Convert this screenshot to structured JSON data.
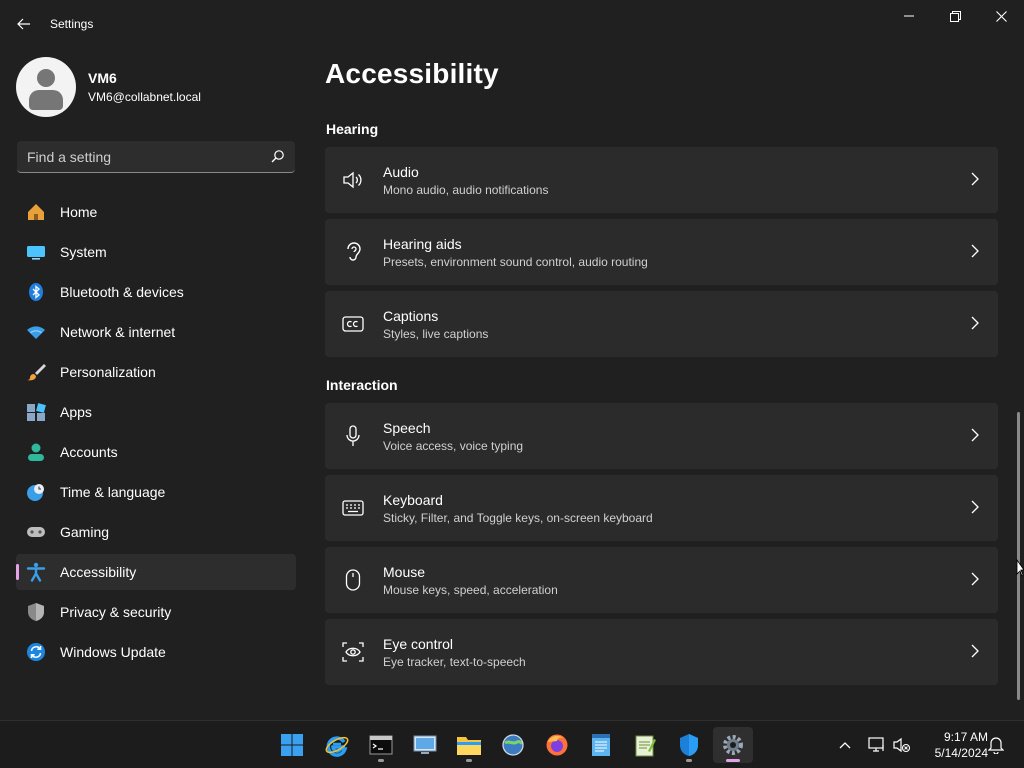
{
  "window": {
    "title": "Settings"
  },
  "profile": {
    "name": "VM6",
    "email": "VM6@collabnet.local"
  },
  "search": {
    "placeholder": "Find a setting"
  },
  "sidebar": {
    "items": [
      {
        "label": "Home",
        "icon": "home-icon"
      },
      {
        "label": "System",
        "icon": "system-icon"
      },
      {
        "label": "Bluetooth & devices",
        "icon": "bluetooth-icon"
      },
      {
        "label": "Network & internet",
        "icon": "network-icon"
      },
      {
        "label": "Personalization",
        "icon": "brush-icon"
      },
      {
        "label": "Apps",
        "icon": "apps-icon"
      },
      {
        "label": "Accounts",
        "icon": "accounts-icon"
      },
      {
        "label": "Time & language",
        "icon": "time-language-icon"
      },
      {
        "label": "Gaming",
        "icon": "gamepad-icon"
      },
      {
        "label": "Accessibility",
        "icon": "accessibility-icon",
        "active": true
      },
      {
        "label": "Privacy & security",
        "icon": "shield-icon"
      },
      {
        "label": "Windows Update",
        "icon": "update-icon"
      }
    ]
  },
  "main": {
    "title": "Accessibility",
    "sections": [
      {
        "heading": "Hearing",
        "cards": [
          {
            "title": "Audio",
            "subtitle": "Mono audio, audio notifications",
            "icon": "speaker-icon"
          },
          {
            "title": "Hearing aids",
            "subtitle": "Presets, environment sound control, audio routing",
            "icon": "ear-icon"
          },
          {
            "title": "Captions",
            "subtitle": "Styles, live captions",
            "icon": "closed-captions-icon"
          }
        ]
      },
      {
        "heading": "Interaction",
        "cards": [
          {
            "title": "Speech",
            "subtitle": "Voice access, voice typing",
            "icon": "microphone-icon"
          },
          {
            "title": "Keyboard",
            "subtitle": "Sticky, Filter, and Toggle keys, on-screen keyboard",
            "icon": "keyboard-icon"
          },
          {
            "title": "Mouse",
            "subtitle": "Mouse keys, speed, acceleration",
            "icon": "mouse-icon"
          },
          {
            "title": "Eye control",
            "subtitle": "Eye tracker, text-to-speech",
            "icon": "eye-control-icon"
          }
        ]
      }
    ]
  },
  "taskbar": {
    "apps": [
      "start-icon",
      "internet-explorer-icon",
      "terminal-icon",
      "remote-desktop-icon",
      "file-explorer-icon",
      "network-globe-icon",
      "firefox-icon",
      "notepad-icon",
      "notepad-plus-icon",
      "defender-icon",
      "settings-icon"
    ],
    "time": "9:17 AM",
    "date": "5/14/2024"
  },
  "colors": {
    "background": "#202020",
    "card": "#2b2b2b",
    "accent": "#e5a3e7",
    "taskbar": "#1c1c1c"
  }
}
